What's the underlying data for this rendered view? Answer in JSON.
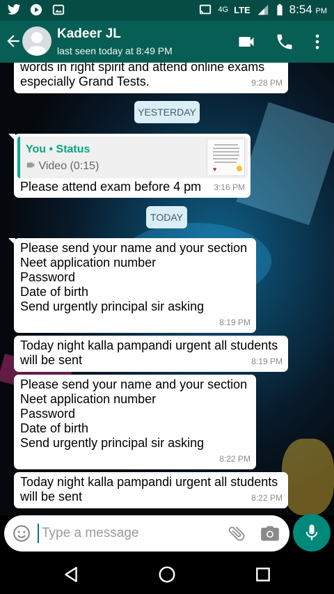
{
  "status_bar": {
    "network": "4G",
    "lte": "LTE",
    "time": "8:54",
    "ampm": "PM",
    "icons": [
      "twitter-icon",
      "youtube-icon",
      "gallery-icon",
      "cast-icon",
      "signal-icon",
      "battery-icon"
    ]
  },
  "header": {
    "contact_name": "Kadeer JL",
    "last_seen": "last seen today at 8:49 PM",
    "icons": [
      "back-arrow-icon",
      "avatar",
      "video-call-icon",
      "phone-icon",
      "more-vert-icon"
    ]
  },
  "messages": [
    {
      "text": "words in right spirit and attend online exams\nespecially Grand Tests.",
      "time": "9:28 PM"
    },
    {
      "text": "Please attend exam before 4 pm",
      "time": "3:16 PM",
      "quote": {
        "author": "You • Status",
        "kind": "Video (0:15)"
      }
    },
    {
      "text": "Please send your name and your section\nNeet application number\nPassword\nDate of birth\nSend urgently principal sir asking",
      "time": "8:19 PM"
    },
    {
      "text": "Today night kalla pampandi urgent all students\nwill be sent",
      "time": "8:19 PM"
    },
    {
      "text": "Please send your name and your section\nNeet application number\nPassword\nDate of birth\nSend urgently principal sir asking",
      "time": "8:22 PM"
    },
    {
      "text": "Today night kalla pampandi urgent all students\nwill be sent",
      "time": "8:22 PM"
    }
  ],
  "date_chips": {
    "yesterday": "YESTERDAY",
    "today": "TODAY"
  },
  "composer": {
    "placeholder": "Type a message",
    "icons": [
      "emoji-icon",
      "attach-icon",
      "camera-icon",
      "mic-icon"
    ]
  },
  "colors": {
    "header": "#075e54",
    "status_bar": "#054d44",
    "accent": "#06a884",
    "mic": "#00897b",
    "date_chip": "#d9eef7"
  }
}
